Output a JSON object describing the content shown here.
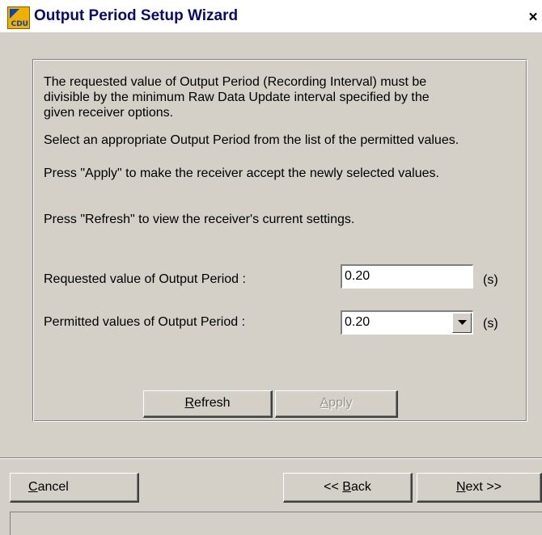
{
  "window": {
    "title": "Output Period Setup Wizard",
    "close_label": "×",
    "icon_text": "CDU"
  },
  "instructions": {
    "line1": "The requested value of Output Period (Recording Interval) must be",
    "line2": "divisible by the minimum Raw Data Update interval specified by the",
    "line3": "given receiver options.",
    "line4": "Select an appropriate Output Period from the list of the permitted values.",
    "line5": "Press \"Apply\" to make the receiver accept the newly selected values.",
    "line6": "Press \"Refresh\" to view the receiver's current settings."
  },
  "requested": {
    "label": "Requested value of Output Period :",
    "value": "0.20",
    "unit": "(s)"
  },
  "permitted": {
    "label": "Permitted values of Output Period :",
    "selected": "0.20",
    "unit": "(s)"
  },
  "buttons": {
    "refresh_accel": "R",
    "refresh_rest": "efresh",
    "apply_accel": "A",
    "apply_rest": "pply",
    "cancel_accel": "C",
    "cancel_rest": "ancel",
    "back_prefix": "<< ",
    "back_accel": "B",
    "back_rest": "ack",
    "next_accel": "N",
    "next_rest": "ext >>"
  },
  "colors": {
    "dialog_bg": "#d4d0c8",
    "title_text": "#0a0a6a",
    "disabled_text": "#9a968c"
  }
}
